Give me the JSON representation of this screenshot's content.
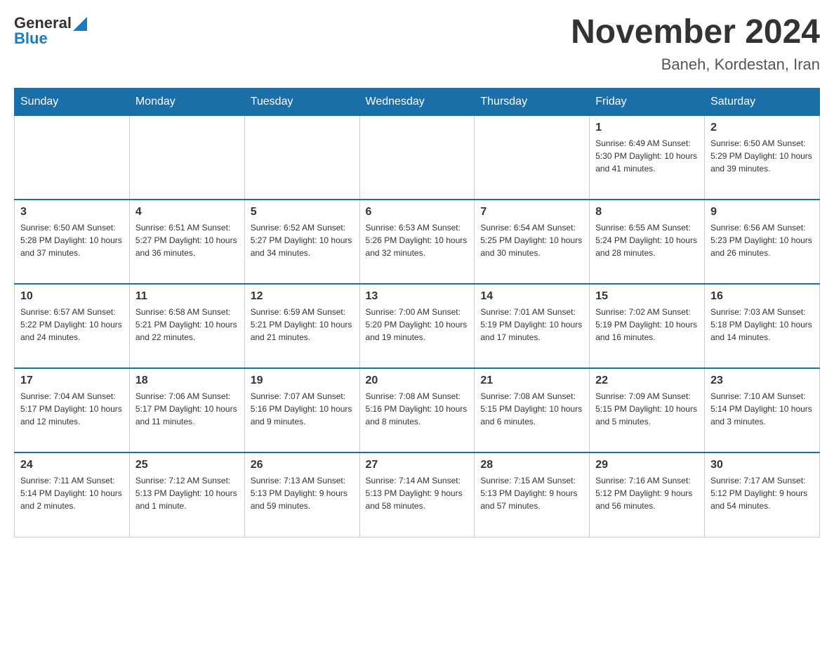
{
  "header": {
    "logo": {
      "text_general": "General",
      "text_blue": "Blue"
    },
    "title": "November 2024",
    "subtitle": "Baneh, Kordestan, Iran"
  },
  "calendar": {
    "weekdays": [
      "Sunday",
      "Monday",
      "Tuesday",
      "Wednesday",
      "Thursday",
      "Friday",
      "Saturday"
    ],
    "weeks": [
      [
        {
          "day": "",
          "info": ""
        },
        {
          "day": "",
          "info": ""
        },
        {
          "day": "",
          "info": ""
        },
        {
          "day": "",
          "info": ""
        },
        {
          "day": "",
          "info": ""
        },
        {
          "day": "1",
          "info": "Sunrise: 6:49 AM\nSunset: 5:30 PM\nDaylight: 10 hours and 41 minutes."
        },
        {
          "day": "2",
          "info": "Sunrise: 6:50 AM\nSunset: 5:29 PM\nDaylight: 10 hours and 39 minutes."
        }
      ],
      [
        {
          "day": "3",
          "info": "Sunrise: 6:50 AM\nSunset: 5:28 PM\nDaylight: 10 hours and 37 minutes."
        },
        {
          "day": "4",
          "info": "Sunrise: 6:51 AM\nSunset: 5:27 PM\nDaylight: 10 hours and 36 minutes."
        },
        {
          "day": "5",
          "info": "Sunrise: 6:52 AM\nSunset: 5:27 PM\nDaylight: 10 hours and 34 minutes."
        },
        {
          "day": "6",
          "info": "Sunrise: 6:53 AM\nSunset: 5:26 PM\nDaylight: 10 hours and 32 minutes."
        },
        {
          "day": "7",
          "info": "Sunrise: 6:54 AM\nSunset: 5:25 PM\nDaylight: 10 hours and 30 minutes."
        },
        {
          "day": "8",
          "info": "Sunrise: 6:55 AM\nSunset: 5:24 PM\nDaylight: 10 hours and 28 minutes."
        },
        {
          "day": "9",
          "info": "Sunrise: 6:56 AM\nSunset: 5:23 PM\nDaylight: 10 hours and 26 minutes."
        }
      ],
      [
        {
          "day": "10",
          "info": "Sunrise: 6:57 AM\nSunset: 5:22 PM\nDaylight: 10 hours and 24 minutes."
        },
        {
          "day": "11",
          "info": "Sunrise: 6:58 AM\nSunset: 5:21 PM\nDaylight: 10 hours and 22 minutes."
        },
        {
          "day": "12",
          "info": "Sunrise: 6:59 AM\nSunset: 5:21 PM\nDaylight: 10 hours and 21 minutes."
        },
        {
          "day": "13",
          "info": "Sunrise: 7:00 AM\nSunset: 5:20 PM\nDaylight: 10 hours and 19 minutes."
        },
        {
          "day": "14",
          "info": "Sunrise: 7:01 AM\nSunset: 5:19 PM\nDaylight: 10 hours and 17 minutes."
        },
        {
          "day": "15",
          "info": "Sunrise: 7:02 AM\nSunset: 5:19 PM\nDaylight: 10 hours and 16 minutes."
        },
        {
          "day": "16",
          "info": "Sunrise: 7:03 AM\nSunset: 5:18 PM\nDaylight: 10 hours and 14 minutes."
        }
      ],
      [
        {
          "day": "17",
          "info": "Sunrise: 7:04 AM\nSunset: 5:17 PM\nDaylight: 10 hours and 12 minutes."
        },
        {
          "day": "18",
          "info": "Sunrise: 7:06 AM\nSunset: 5:17 PM\nDaylight: 10 hours and 11 minutes."
        },
        {
          "day": "19",
          "info": "Sunrise: 7:07 AM\nSunset: 5:16 PM\nDaylight: 10 hours and 9 minutes."
        },
        {
          "day": "20",
          "info": "Sunrise: 7:08 AM\nSunset: 5:16 PM\nDaylight: 10 hours and 8 minutes."
        },
        {
          "day": "21",
          "info": "Sunrise: 7:08 AM\nSunset: 5:15 PM\nDaylight: 10 hours and 6 minutes."
        },
        {
          "day": "22",
          "info": "Sunrise: 7:09 AM\nSunset: 5:15 PM\nDaylight: 10 hours and 5 minutes."
        },
        {
          "day": "23",
          "info": "Sunrise: 7:10 AM\nSunset: 5:14 PM\nDaylight: 10 hours and 3 minutes."
        }
      ],
      [
        {
          "day": "24",
          "info": "Sunrise: 7:11 AM\nSunset: 5:14 PM\nDaylight: 10 hours and 2 minutes."
        },
        {
          "day": "25",
          "info": "Sunrise: 7:12 AM\nSunset: 5:13 PM\nDaylight: 10 hours and 1 minute."
        },
        {
          "day": "26",
          "info": "Sunrise: 7:13 AM\nSunset: 5:13 PM\nDaylight: 9 hours and 59 minutes."
        },
        {
          "day": "27",
          "info": "Sunrise: 7:14 AM\nSunset: 5:13 PM\nDaylight: 9 hours and 58 minutes."
        },
        {
          "day": "28",
          "info": "Sunrise: 7:15 AM\nSunset: 5:13 PM\nDaylight: 9 hours and 57 minutes."
        },
        {
          "day": "29",
          "info": "Sunrise: 7:16 AM\nSunset: 5:12 PM\nDaylight: 9 hours and 56 minutes."
        },
        {
          "day": "30",
          "info": "Sunrise: 7:17 AM\nSunset: 5:12 PM\nDaylight: 9 hours and 54 minutes."
        }
      ]
    ]
  }
}
